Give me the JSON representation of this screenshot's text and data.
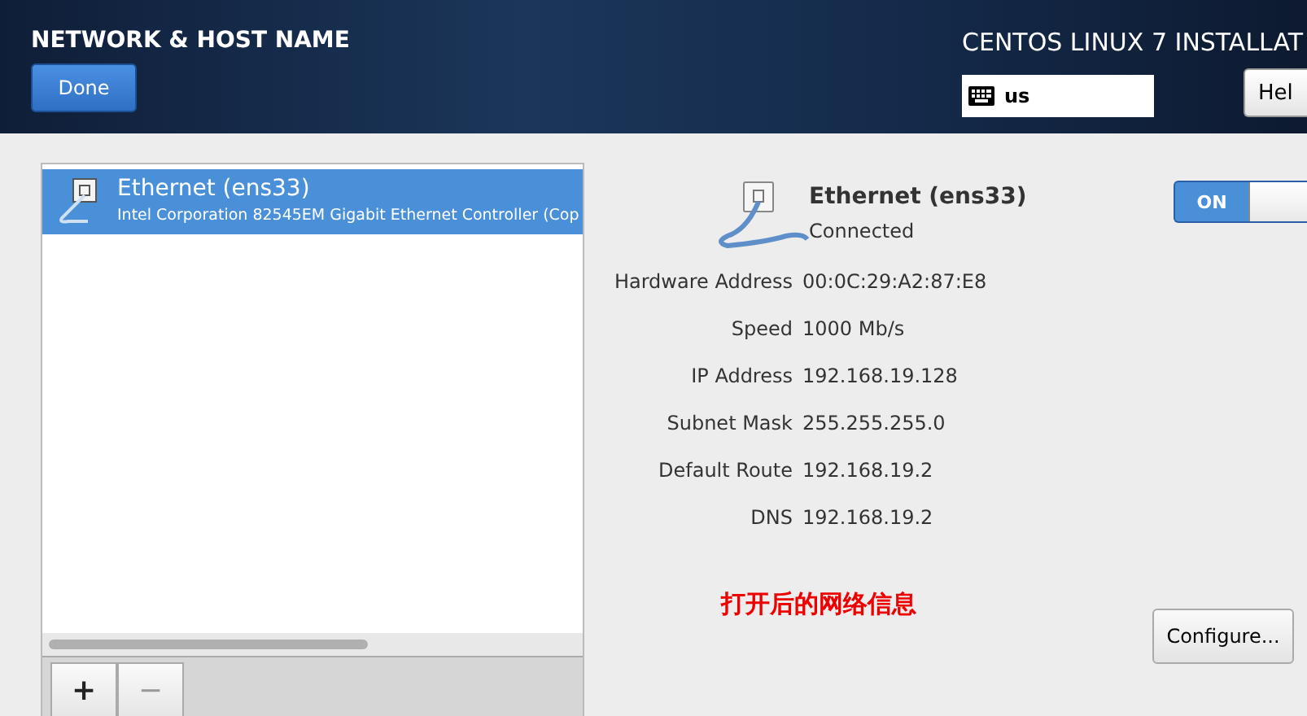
{
  "header": {
    "title": "NETWORK & HOST NAME",
    "done_button": "Done",
    "product": "CENTOS LINUX 7 INSTALLAT",
    "keyboard": {
      "value": "us"
    },
    "help_button": "Hel"
  },
  "devices": [
    {
      "name": "Ethernet (ens33)",
      "description": "Intel Corporation 82545EM Gigabit Ethernet Controller (Cop",
      "selected": true
    }
  ],
  "list_buttons": [
    {
      "label": "+",
      "disabled": false
    },
    {
      "label": "−",
      "disabled": true
    }
  ],
  "details": {
    "name": "Ethernet (ens33)",
    "status": "Connected",
    "switch": {
      "label": "ON",
      "on": true
    },
    "rows": [
      {
        "label": "Hardware Address",
        "value": "00:0C:29:A2:87:E8"
      },
      {
        "label": "Speed",
        "value": "1000 Mb/s"
      },
      {
        "label": "IP Address",
        "value": "192.168.19.128"
      },
      {
        "label": "Subnet Mask",
        "value": "255.255.255.0"
      },
      {
        "label": "Default Route",
        "value": "192.168.19.2"
      },
      {
        "label": "DNS",
        "value": "192.168.19.2"
      }
    ],
    "annotation": "打开后的网络信息",
    "configure_button": "Configure..."
  }
}
